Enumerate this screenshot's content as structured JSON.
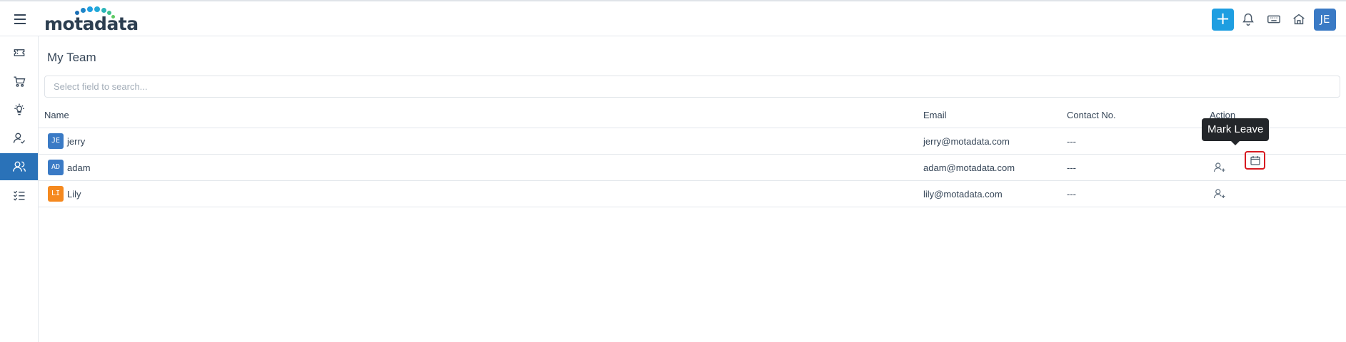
{
  "header": {
    "logo_text": "motadata",
    "avatar_initials": "JE",
    "add_label": "+",
    "icons": [
      "menu-icon",
      "plus-icon",
      "bell-icon",
      "keyboard-icon",
      "home-icon"
    ]
  },
  "sidebar": {
    "items": [
      {
        "icon": "ticket-icon",
        "active": false
      },
      {
        "icon": "cart-icon",
        "active": false
      },
      {
        "icon": "lightbulb-icon",
        "active": false
      },
      {
        "icon": "user-check-icon",
        "active": false
      },
      {
        "icon": "users-icon",
        "active": true
      },
      {
        "icon": "checklist-icon",
        "active": false
      }
    ]
  },
  "main": {
    "title": "My Team",
    "search_placeholder": "Select field to search...",
    "columns": {
      "name": "Name",
      "email": "Email",
      "contact": "Contact No.",
      "action": "Action"
    },
    "rows": [
      {
        "initials": "JE",
        "name": "jerry",
        "email": "jerry@motadata.com",
        "contact": "---",
        "color": "#3a7ac5"
      },
      {
        "initials": "AD",
        "name": "adam",
        "email": "adam@motadata.com",
        "contact": "---",
        "color": "#3a7ac5"
      },
      {
        "initials": "LI",
        "name": "Lily",
        "email": "lily@motadata.com",
        "contact": "---",
        "color": "#f5891f"
      }
    ],
    "tooltip": "Mark Leave"
  },
  "colors": {
    "accent": "#1e9ee1",
    "sidebar_active": "#2a72b8",
    "highlight": "#d71920"
  }
}
